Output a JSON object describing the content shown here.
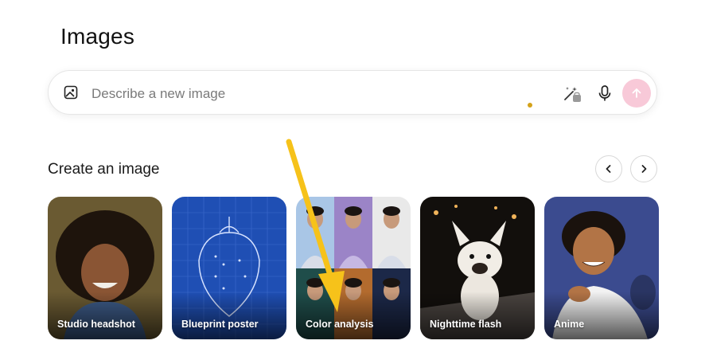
{
  "page": {
    "title": "Images"
  },
  "prompt": {
    "placeholder": "Describe a new image",
    "value": "",
    "icons": [
      "image-icon",
      "magic-wand-icon",
      "microphone-icon",
      "arrow-up-icon"
    ]
  },
  "create": {
    "section_title": "Create an image",
    "nav": [
      "chevron-left-icon",
      "chevron-right-icon"
    ],
    "cards": [
      {
        "label": "Studio headshot"
      },
      {
        "label": "Blueprint poster"
      },
      {
        "label": "Color analysis"
      },
      {
        "label": "Nighttime flash"
      },
      {
        "label": "Anime"
      }
    ]
  },
  "colors": {
    "accent_send": "#f8c9d8",
    "annotation_arrow": "#f6c21a",
    "dot": "#d4a21a"
  }
}
